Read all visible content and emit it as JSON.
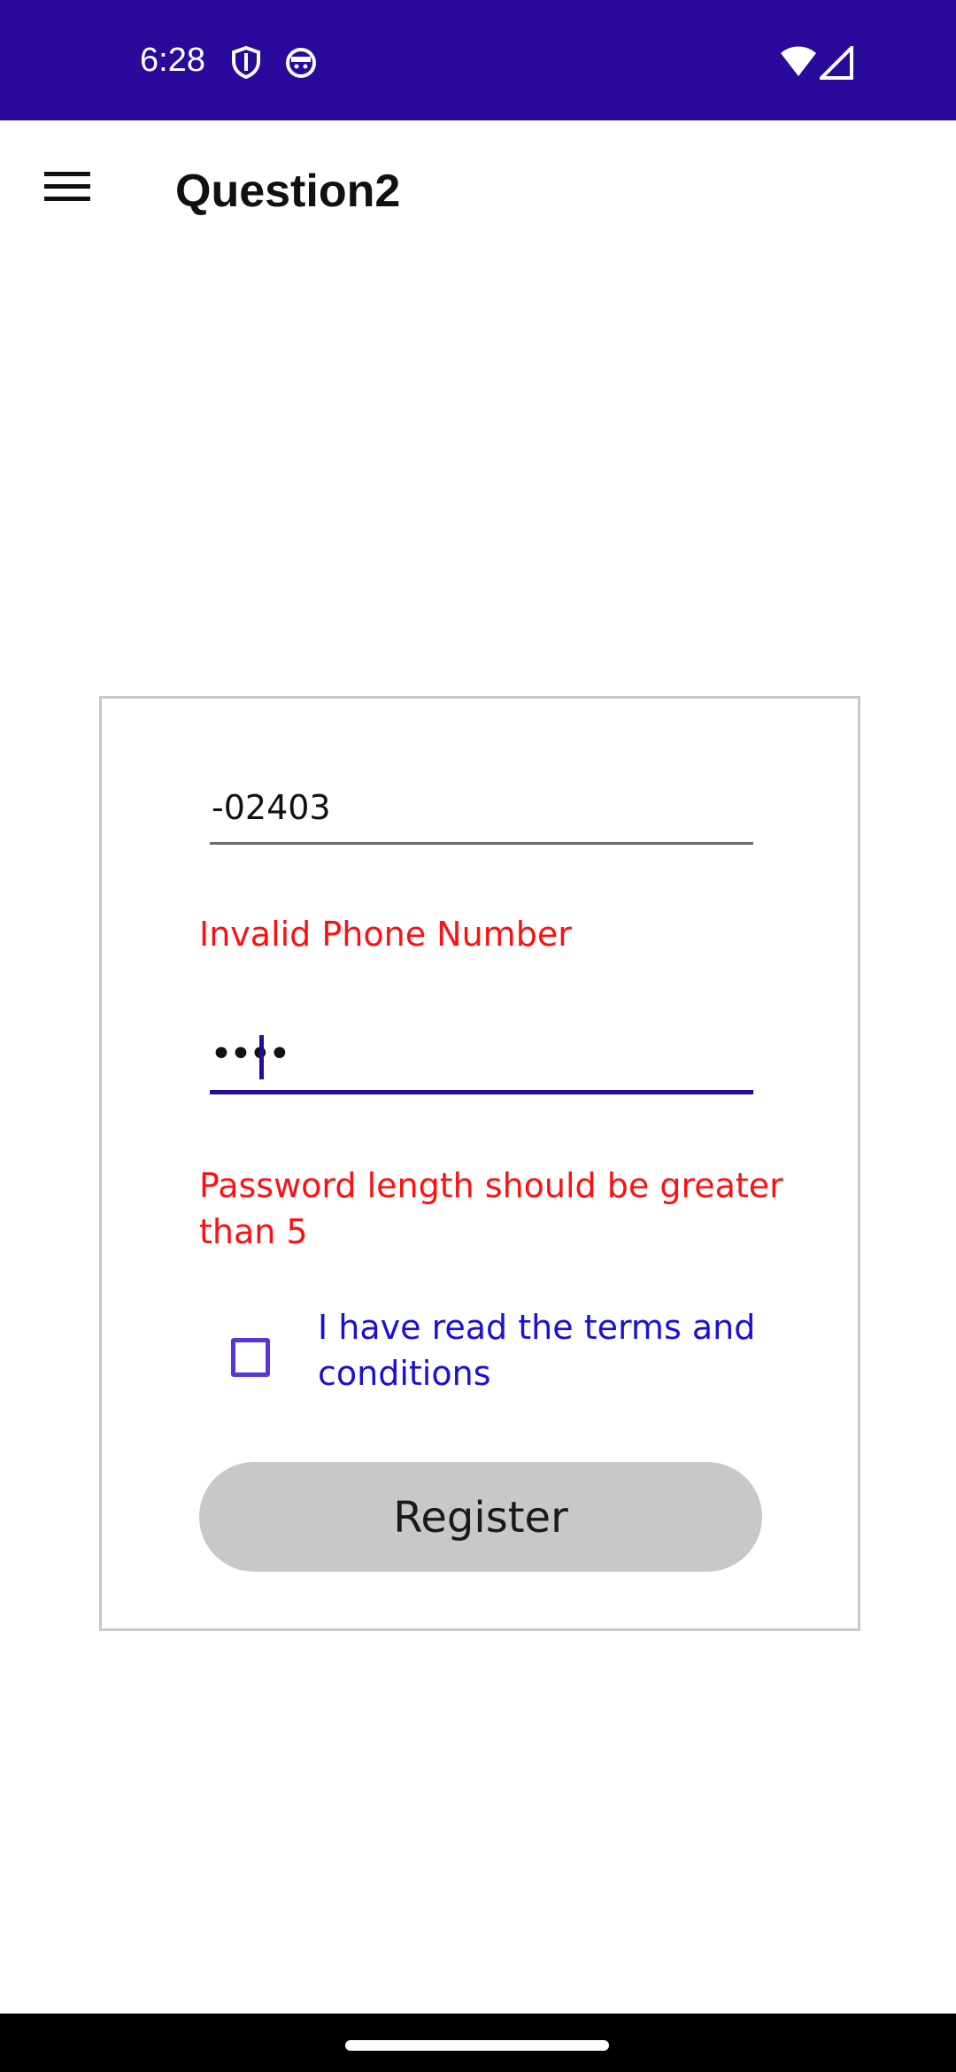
{
  "status_bar": {
    "time": "6:28",
    "left_icons": [
      "shield-icon",
      "android-face-icon"
    ],
    "right_icons": [
      "wifi-icon",
      "signal-icon"
    ],
    "background_color": "#2a0a9a"
  },
  "app_bar": {
    "menu_icon": "hamburger-menu-icon",
    "title": "Question2"
  },
  "form": {
    "phone_value": "-02403",
    "phone_error": "Invalid Phone Number",
    "password_value": "••••",
    "password_error": "Password length should be greater than 5",
    "terms_checked": false,
    "terms_label": "I have read the terms and conditions",
    "register_label": "Register"
  },
  "colors": {
    "accent": "#2a0a9a",
    "error": "#ff1010",
    "link_text": "#1a10d8",
    "checkbox": "#5b35d5",
    "button_disabled": "#c8c8c8"
  }
}
